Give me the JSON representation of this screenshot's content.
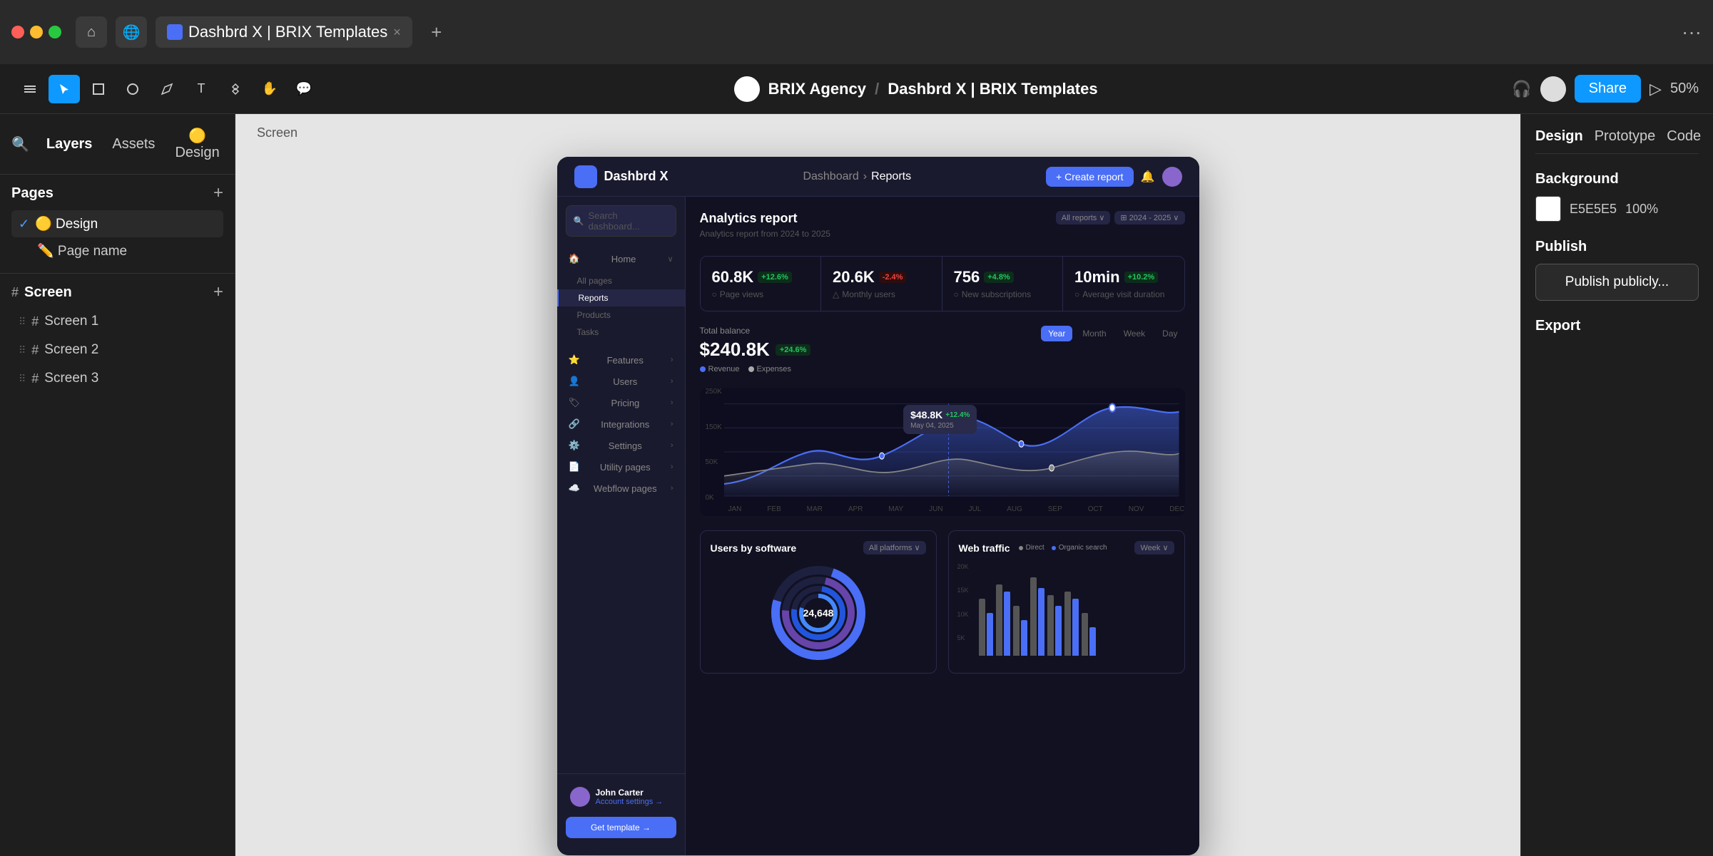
{
  "browser": {
    "tab_title": "Dashbrd X | BRIX Templates",
    "tab_close": "×",
    "tab_plus": "+",
    "more": "···"
  },
  "toolbar": {
    "brand": "BRIX Agency",
    "separator": "/",
    "doc_title": "Dashbrd X | BRIX Templates",
    "share_label": "Share",
    "zoom": "50%",
    "layers_tab": "Layers",
    "assets_tab": "Assets",
    "design_tab": "🟡 Design"
  },
  "pages": {
    "title": "Pages",
    "add": "+",
    "items": [
      {
        "name": "🟡 Design",
        "active": true,
        "check": true
      },
      {
        "name": "✏️ Page name",
        "active": false
      }
    ]
  },
  "layers": {
    "screen_title": "Screen",
    "add": "+",
    "items": [
      {
        "name": "Screen 1"
      },
      {
        "name": "Screen 2"
      },
      {
        "name": "Screen 3"
      }
    ]
  },
  "canvas": {
    "label": "Screen"
  },
  "dashboard": {
    "logo_text": "Dashbrd X",
    "breadcrumb_root": "Dashboard",
    "breadcrumb_sep": "›",
    "breadcrumb_current": "Reports",
    "create_btn": "+ Create report",
    "search_placeholder": "Search dashboard...",
    "nav": {
      "home": "Home",
      "home_sub": [
        "All pages",
        "Reports",
        "Products",
        "Tasks"
      ],
      "features": "Features",
      "users": "Users",
      "pricing": "Pricing",
      "integrations": "Integrations",
      "settings": "Settings",
      "utility_pages": "Utility pages",
      "webflow_pages": "Webflow pages"
    },
    "user": {
      "name": "John Carter",
      "sub": "Account settings →"
    },
    "get_template": "Get template →",
    "analytics": {
      "title": "Analytics report",
      "subtitle": "Analytics report from 2024 to 2025",
      "filter_all": "All reports ∨",
      "filter_year": "⊞ 2024 - 2025 ∨",
      "stats": [
        {
          "value": "60.8K",
          "badge": "+12.6%",
          "badge_type": "green",
          "label": "Page views",
          "icon": "○"
        },
        {
          "value": "20.6K",
          "badge": "-2.4%",
          "badge_type": "red",
          "label": "Monthly users",
          "icon": "△"
        },
        {
          "value": "756",
          "badge": "+4.8%",
          "badge_type": "green",
          "label": "New subscriptions",
          "icon": "○"
        },
        {
          "value": "10min",
          "badge": "+10.2%",
          "badge_type": "green",
          "label": "Average visit duration",
          "icon": "○"
        }
      ]
    },
    "balance": {
      "label": "Total balance",
      "value": "$240.8K",
      "badge": "+24.6%",
      "legend": [
        "Revenue",
        "Expenses"
      ],
      "periods": [
        "Year",
        "Month",
        "Week",
        "Day"
      ],
      "active_period": "Year",
      "chart_tooltip": {
        "value": "$48.8K",
        "badge": "+12.4%",
        "date": "May 04, 2025"
      },
      "y_labels": [
        "250K",
        "150K",
        "50K",
        "0K"
      ],
      "x_labels": [
        "JAN",
        "FEB",
        "MAR",
        "APR",
        "MAY",
        "JUN",
        "JUL",
        "AUG",
        "SEP",
        "OCT",
        "NOV",
        "DEC"
      ]
    },
    "users_by_software": {
      "title": "Users by software",
      "filter": "All platforms ∨",
      "donut_value": "24,648"
    },
    "web_traffic": {
      "title": "Web traffic",
      "legend": [
        "Direct",
        "Organic search"
      ],
      "filter": "Week ∨"
    }
  },
  "right_panel": {
    "tabs": [
      "Design",
      "Prototype",
      "Code"
    ],
    "active_tab": "Design",
    "background_section": "Background",
    "bg_hex": "E5E5E5",
    "bg_opacity": "100%",
    "publish_section": "Publish",
    "publish_btn": "Publish publicly...",
    "export_section": "Export"
  }
}
